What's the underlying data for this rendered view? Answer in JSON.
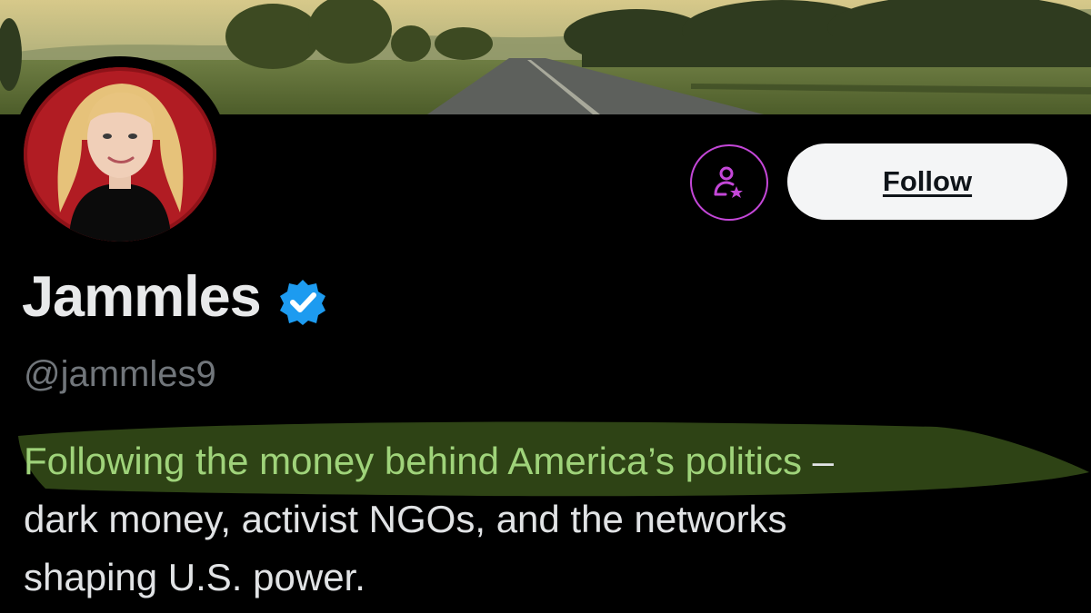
{
  "profile": {
    "display_name": "Jammles",
    "handle": "@jammles9",
    "verified": true,
    "bio_highlight": "Following the money behind America’s politics",
    "bio_separator": " –",
    "bio_line_2": "dark money, activist NGOs, and the networks",
    "bio_line_3": "shaping U.S. power."
  },
  "actions": {
    "follow_label": "Follow",
    "subscribe_icon": "person-star-icon"
  },
  "icons": {
    "verified": "verified-badge-icon"
  },
  "colors": {
    "background": "#000000",
    "highlight_text": "#9fd37a",
    "highlight_marker": "#3e5a1c",
    "subscribe_accent": "#c447d8",
    "verified_blue": "#1d9bf0",
    "avatar_bg": "#b11c23",
    "follow_bg": "#f4f5f6"
  }
}
